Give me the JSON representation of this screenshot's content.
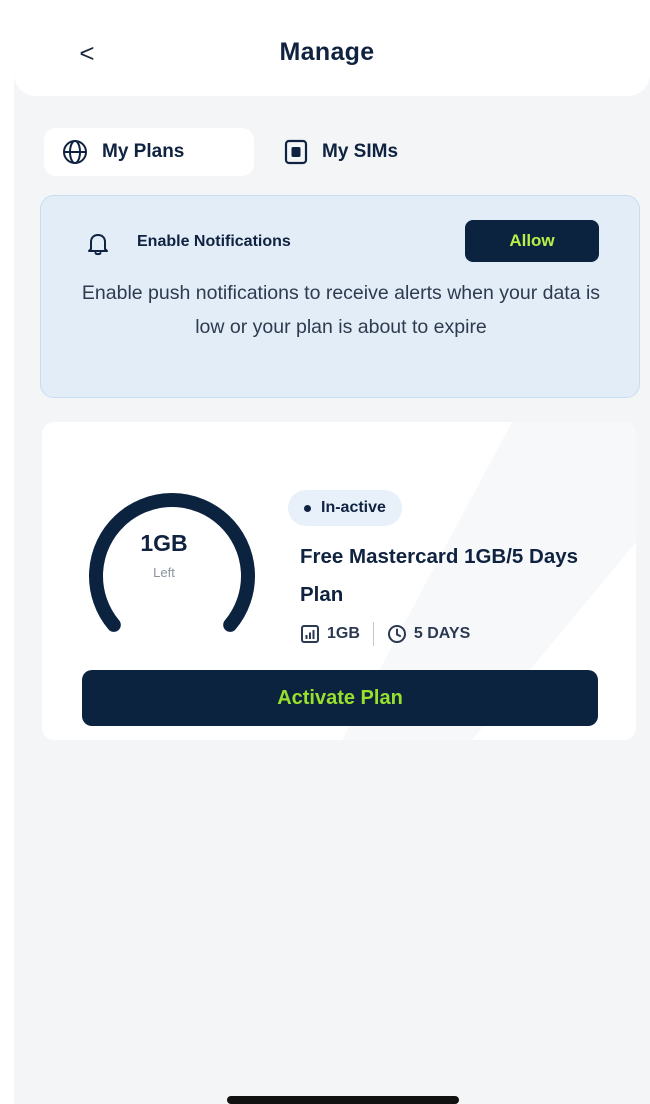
{
  "header": {
    "back_icon": "chevron-left-icon",
    "back_glyph": "<",
    "title": "Manage"
  },
  "tabs": [
    {
      "label": "My Plans",
      "icon": "globe-icon",
      "active": true
    },
    {
      "label": "My SIMs",
      "icon": "sim-card-icon",
      "active": false
    }
  ],
  "notification": {
    "icon": "bell-icon",
    "title": "Enable Notifications",
    "allow_label": "Allow",
    "body": "Enable push notifications to receive alerts when your data is low or your plan is about to expire"
  },
  "plan": {
    "remaining_value": "1GB",
    "remaining_label": "Left",
    "remaining_fraction": 1.0,
    "status": "In-active",
    "name": "Free Mastercard 1GB/5 Days Plan",
    "data_icon": "data-chart-icon",
    "data_amount": "1GB",
    "validity_icon": "clock-icon",
    "validity": "5 DAYS",
    "activate_label": "Activate Plan"
  },
  "colors": {
    "brand_navy": "#0c2340",
    "accent_green": "#98e02c",
    "banner_bg": "#e2edf8",
    "page_bg": "#f4f5f7"
  }
}
